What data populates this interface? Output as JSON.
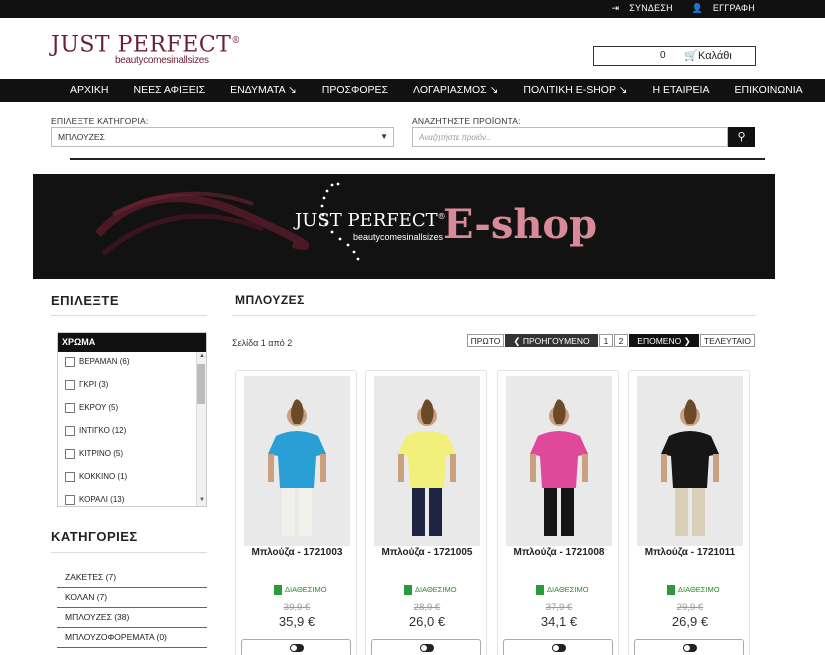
{
  "topbar": {
    "login": "ΣΥΝΔΕΣΗ",
    "register": "ΕΓΓΡΑΦΗ"
  },
  "logo": {
    "main": "JUST PERFECT",
    "reg": "®",
    "tagline": "beautycomesinallsizes"
  },
  "cart": {
    "count": "0",
    "label": "Καλάθι"
  },
  "nav": [
    "ΑΡΧΙΚΗ",
    "ΝΕΕΣ ΑΦΙΞΕΙΣ",
    "ΕΝΔΥΜΑΤΑ ↘",
    "ΠΡΟΣΦΟΡΕΣ",
    "ΛΟΓΑΡΙΑΣΜΟΣ ↘",
    "ΠΟΛΙΤΙΚΗ E-SHOP ↘",
    "Η ΕΤΑΙΡΕΙΑ",
    "ΕΠΙΚΟΙΝΩΝΙΑ"
  ],
  "filters": {
    "category_label": "ΕΠΙΛΕΞΤΕ ΚΑΤΗΓΟΡΙΑ:",
    "category_value": "ΜΠΛΟΥΖΕΣ",
    "search_label": "ΑΝΑΖΗΤΗΣΤΕ ΠΡΟΪΟΝΤΑ:",
    "search_placeholder": "Αναζητήστε προϊόν.."
  },
  "banner": {
    "brand": "JUST PERFECT",
    "reg": "®",
    "tagline": "beautycomesinallsizes",
    "eshop": "E-shop"
  },
  "sidebar": {
    "title": "ΕΠΙΛΕΞΤΕ",
    "color_header": "ΧΡΩΜΑ",
    "colors": [
      "ΒΕΡΑΜΑΝ (6)",
      "ΓΚΡΙ (3)",
      "ΕΚΡΟΥ (5)",
      "ΙΝΤΙΓΚΟ (12)",
      "ΚΙΤΡΙΝΟ (5)",
      "ΚΟΚΚΙΝΟ (1)",
      "ΚΟΡΑΛΙ (13)"
    ],
    "categories_title": "ΚΑΤΗΓΟΡΙΕΣ",
    "categories": [
      "ΖΑΚΕΤΕΣ (7)",
      "ΚΟΛΑΝ (7)",
      "ΜΠΛΟΥΖΕΣ (38)",
      "ΜΠΛΟΥΖΟΦΟΡΕΜΑΤΑ (0)"
    ]
  },
  "main": {
    "title": "ΜΠΛΟΥΖΕΣ",
    "page_info": "Σελίδα 1 από 2",
    "pager": {
      "first": "ΠΡΩΤΟ",
      "prev": "ΠΡΟΗΓΟΥΜΕΝΟ",
      "p1": "1",
      "p2": "2",
      "next": "ΕΠΟΜΕΝΟ",
      "last": "ΤΕΛΕΥΤΑΙΟ"
    }
  },
  "products": [
    {
      "name": "Μπλούζα - 1721003",
      "stock": "ΔΙΑΘΕΣΙΜΟ",
      "old_price": "39,9 €",
      "price": "35,9 €",
      "top_color": "#2a9fd6",
      "bottom_color": "#f2f0ea"
    },
    {
      "name": "Μπλούζα - 1721005",
      "stock": "ΔΙΑΘΕΣΙΜΟ",
      "old_price": "28,9 €",
      "price": "26,0 €",
      "top_color": "#f1f07a",
      "bottom_color": "#1e2442"
    },
    {
      "name": "Μπλούζα - 1721008",
      "stock": "ΔΙΑΘΕΣΙΜΟ",
      "old_price": "37,9 €",
      "price": "34,1 €",
      "top_color": "#e0489a",
      "bottom_color": "#151515"
    },
    {
      "name": "Μπλούζα - 1721011",
      "stock": "ΔΙΑΘΕΣΙΜΟ",
      "old_price": "29,9 €",
      "price": "26,9 €",
      "top_color": "#161616",
      "bottom_color": "#d8cfb6"
    }
  ]
}
